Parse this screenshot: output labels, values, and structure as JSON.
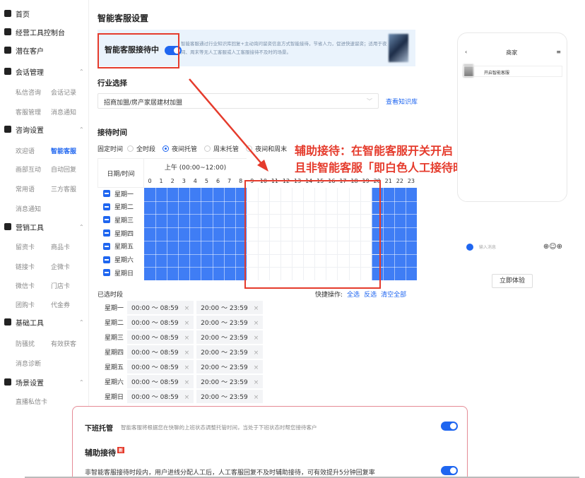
{
  "sidebar": {
    "groups": [
      {
        "label": "首页",
        "icon": "home-icon"
      },
      {
        "label": "经营工具控制台",
        "icon": "dashboard-icon"
      },
      {
        "label": "潜在客户",
        "icon": "users-icon"
      },
      {
        "label": "会话管理",
        "icon": "flag-icon"
      },
      {
        "label": "咨询设置",
        "icon": "person-icon"
      },
      {
        "label": "营销工具",
        "icon": "folder-icon"
      },
      {
        "label": "基础工具",
        "icon": "briefcase-icon"
      },
      {
        "label": "场景设置",
        "icon": "target-icon"
      }
    ],
    "subitems": [
      "私信咨询",
      "会话记录",
      "客服管理",
      "消息通知",
      "欢迎语",
      "智能客服",
      "画部互动",
      "自动回复",
      "常用语",
      "三方客服",
      "消息通知",
      "留资卡",
      "商品卡",
      "链接卡",
      "企微卡",
      "微信卡",
      "门店卡",
      "团购卡",
      "代金券",
      "防骚扰",
      "有效获客",
      "消息诊断",
      "直播私信卡"
    ]
  },
  "main": {
    "title": "智能客服设置",
    "banner_label": "智能客服接待中",
    "banner_desc": "智能客服通过行业知识库回复+主动询问留资信息方式智能接待，节省人力，促进快速留资；适用于夜间、周末等无人工客服或人工客服接待不及时的场景。",
    "industry_title": "行业选择",
    "industry_value": "招商加盟/房产家居建材加盟",
    "knowledge_link": "查看知识库",
    "time_title": "接待时间",
    "fixed_label": "固定时间",
    "radios": [
      "全时段",
      "夜间托管",
      "周末托管",
      "夜间和周末"
    ],
    "grid_header": "日期/时间",
    "am_label": "上午 (00:00~12:00)",
    "hours": [
      "0",
      "1",
      "2",
      "3",
      "4",
      "5",
      "6",
      "7",
      "8",
      "9",
      "10",
      "11",
      "12",
      "13",
      "14",
      "15",
      "16",
      "17",
      "18",
      "19",
      "20",
      "21",
      "22",
      "23"
    ],
    "days": [
      "星期一",
      "星期二",
      "星期三",
      "星期四",
      "星期五",
      "星期六",
      "星期日"
    ],
    "selected_title": "已选时段",
    "quick_label": "快捷操作:",
    "quick_all": "全选",
    "quick_invert": "反选",
    "quick_clear": "清空全部",
    "slots": [
      {
        "day": "星期一",
        "a": "00:00 ～ 08:59",
        "b": "20:00 ～ 23:59"
      },
      {
        "day": "星期二",
        "a": "00:00 ～ 08:59",
        "b": "20:00 ～ 23:59"
      },
      {
        "day": "星期三",
        "a": "00:00 ～ 08:59",
        "b": "20:00 ～ 23:59"
      },
      {
        "day": "星期四",
        "a": "00:00 ～ 08:59",
        "b": "20:00 ～ 23:59"
      },
      {
        "day": "星期五",
        "a": "00:00 ～ 08:59",
        "b": "20:00 ～ 23:59"
      },
      {
        "day": "星期六",
        "a": "00:00 ～ 08:59",
        "b": "20:00 ～ 23:59"
      },
      {
        "day": "星期日",
        "a": "00:00 ～ 08:59",
        "b": "20:00 ～ 23:59"
      }
    ],
    "selected_hours_from": 0,
    "selected_hours_to": 8,
    "selected_hours_from2": 20,
    "selected_hours_to2": 23
  },
  "annotation": {
    "line1": "辅助接待：在智能客服开关开启",
    "line2": "且非智能客服「即白色人工接待时段」生效",
    "color": "#e53b2c"
  },
  "phone": {
    "title": "商家",
    "message": "开启智能客服",
    "input_placeholder": "输入消息"
  },
  "try_button": "立即体验",
  "bottom": {
    "t1": "下班托管",
    "d1": "智能客服将根据您在快聊的上班状态调整托管时间，当处于下班状态时帮您接待客户",
    "t2": "辅助接待",
    "new_badge": "新",
    "d2": "非智能客服接待时段内，用户进线分配人工后，人工客服回复不及时辅助接待，可有效提升5分钟回复率"
  },
  "colors": {
    "accent": "#1f66f0",
    "schedule": "#3f7df5",
    "annotation": "#e53b2c"
  }
}
